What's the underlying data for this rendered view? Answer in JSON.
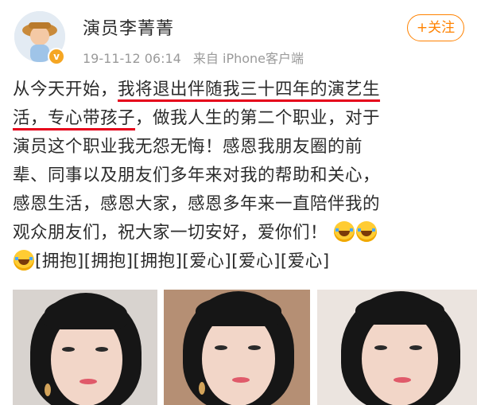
{
  "header": {
    "name": "演员李菁菁",
    "time": "19-11-12 06:14",
    "source": "来自 iPhone客户端",
    "follow_label": "+关注"
  },
  "post": {
    "line1_a": "从今天开始，",
    "line1_b": "我将退出伴随我三十四年的演艺生",
    "line2_a": "活，",
    "line2_b": "专心带孩子",
    "line2_c": "，做我人生的第二个职业，对于",
    "line3": "演员这个职业我无怨无悔！感恩我朋友圈的前",
    "line4": "辈、同事以及朋友们多年来对我的帮助和关心，",
    "line5": "感恩生活，感恩大家，感恩多年来一直陪伴我的",
    "line6": "观众朋友们，祝大家一切安好，爱你们！",
    "line7": "[拥抱][拥抱][拥抱][爱心][爱心][爱心]"
  },
  "icons": {
    "avatar": "cartoon-avatar",
    "verify": "verified-badge-icon",
    "emoji": "laughing-tears-emoji"
  },
  "colors": {
    "accent": "#ff8200",
    "underline": "#e5001a",
    "meta": "#9a9a9a"
  }
}
